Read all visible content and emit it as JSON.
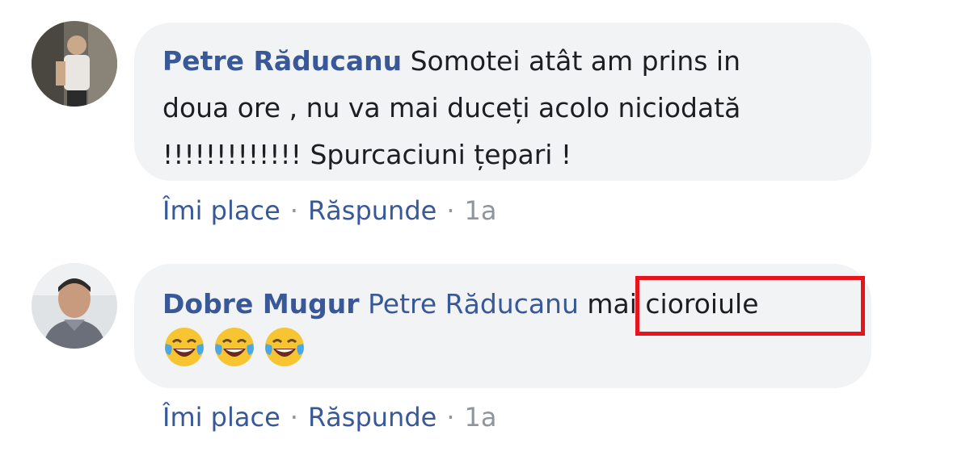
{
  "comments": [
    {
      "author": "Petre Răducanu",
      "lines": [
        "Somotei atât am prins in",
        "doua ore , nu va mai duceți acolo niciodată",
        "!!!!!!!!!!!!! Spurcaciuni țepari !"
      ],
      "actions": {
        "like": "Îmi place",
        "reply": "Răspunde",
        "time": "1a"
      }
    },
    {
      "author": "Dobre Mugur",
      "mention": "Petre Răducanu",
      "text": "mai cioroiule",
      "emojis": [
        "rolling-laughing-emoji",
        "rolling-laughing-emoji",
        "rolling-laughing-emoji"
      ],
      "actions": {
        "like": "Îmi place",
        "reply": "Răspunde",
        "time": "1a"
      }
    }
  ],
  "separator": "·",
  "highlight_color": "#e8131b",
  "link_color": "#385898"
}
